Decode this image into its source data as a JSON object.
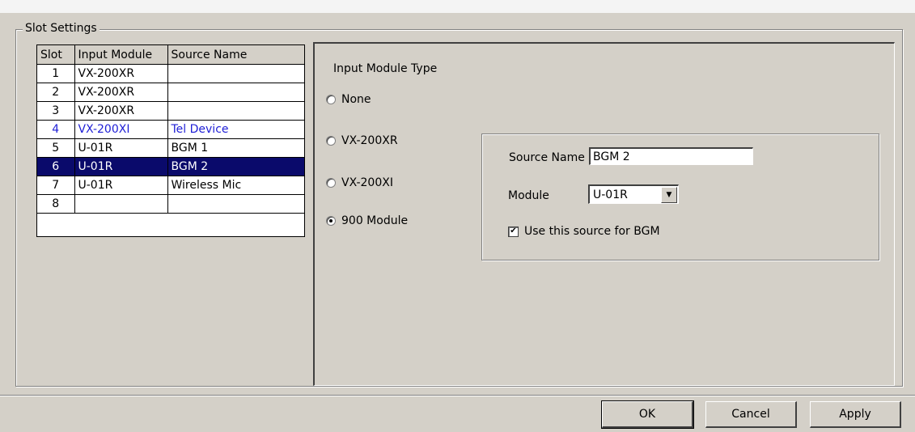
{
  "group_title": "Slot Settings",
  "table": {
    "headers": [
      "Slot",
      "Input Module",
      "Source Name"
    ],
    "rows": [
      {
        "slot": "1",
        "module": "VX-200XR",
        "source": ""
      },
      {
        "slot": "2",
        "module": "VX-200XR",
        "source": ""
      },
      {
        "slot": "3",
        "module": "VX-200XR",
        "source": ""
      },
      {
        "slot": "4",
        "module": "VX-200XI",
        "source": "Tel Device"
      },
      {
        "slot": "5",
        "module": "U-01R",
        "source": "BGM 1"
      },
      {
        "slot": "6",
        "module": "U-01R",
        "source": "BGM 2"
      },
      {
        "slot": "7",
        "module": "U-01R",
        "source": "Wireless Mic"
      },
      {
        "slot": "8",
        "module": "",
        "source": ""
      }
    ],
    "selected_slot": "6",
    "highlight_color": "#1f1fd6",
    "selected_bg": "#0a0a6b"
  },
  "module_type": {
    "label": "Input Module Type",
    "options": [
      "None",
      "VX-200XR",
      "VX-200XI",
      "900 Module"
    ],
    "selected": "900 Module"
  },
  "details": {
    "source_name_label": "Source Name",
    "source_name_value": "BGM 2",
    "module_label": "Module",
    "module_value": "U-01R",
    "use_bgm_label": "Use this source for BGM",
    "use_bgm_checked": true
  },
  "buttons": {
    "ok": "OK",
    "cancel": "Cancel",
    "apply": "Apply"
  }
}
